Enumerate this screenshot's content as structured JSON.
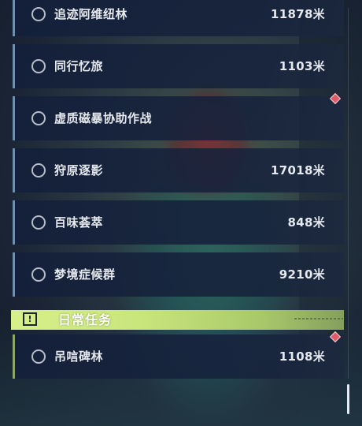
{
  "quests": [
    {
      "name": "追迹阿维纽林",
      "distance": "11878米"
    },
    {
      "name": "同行忆旅",
      "distance": "1103米"
    },
    {
      "name": "虚质磁暴协助作战",
      "distance": ""
    },
    {
      "name": "狩原逐影",
      "distance": "17018米"
    },
    {
      "name": "百味荟萃",
      "distance": "848米"
    },
    {
      "name": "梦境症候群",
      "distance": "9210米"
    }
  ],
  "daily_section": {
    "title": "日常任务",
    "icon": "alert-square-icon",
    "quests": [
      {
        "name": "吊唁碑林",
        "distance": "1108米"
      }
    ]
  },
  "colors": {
    "accent_daily": "#d8f08a",
    "marker": "#e05a68",
    "row_bg": "#14203a"
  }
}
